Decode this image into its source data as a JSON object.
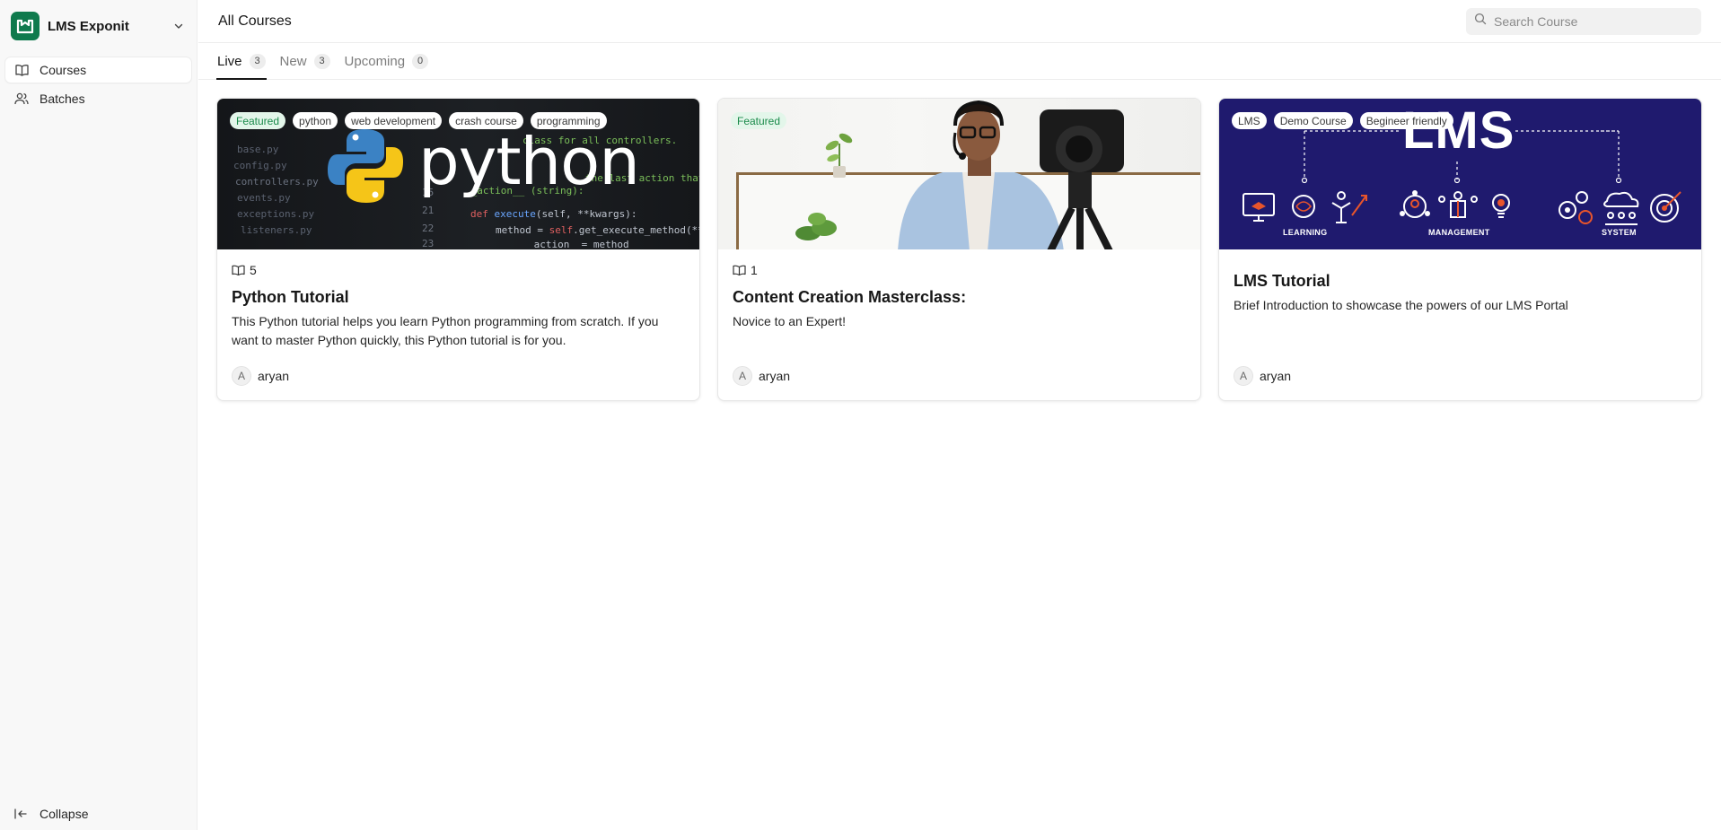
{
  "app": {
    "name": "LMS Exponit",
    "brand_color": "#0f7a4d"
  },
  "sidebar": {
    "items": [
      {
        "label": "Courses",
        "icon": "book-open-icon",
        "active": true
      },
      {
        "label": "Batches",
        "icon": "users-icon",
        "active": false
      }
    ],
    "collapse_label": "Collapse"
  },
  "header": {
    "title": "All Courses",
    "search_placeholder": "Search Course"
  },
  "tabs": [
    {
      "label": "Live",
      "count": "3",
      "active": true
    },
    {
      "label": "New",
      "count": "3",
      "active": false
    },
    {
      "label": "Upcoming",
      "count": "0",
      "active": false
    }
  ],
  "courses": [
    {
      "tags": [
        "Featured",
        "python",
        "web development",
        "crash course",
        "programming"
      ],
      "image_text": "python",
      "lessons": "5",
      "title": "Python Tutorial",
      "description": "This Python tutorial helps you learn Python programming from scratch. If you want to master Python quickly, this Python tutorial is for you.",
      "author_initial": "A",
      "author": "aryan"
    },
    {
      "tags": [
        "Featured"
      ],
      "lessons": "1",
      "title": "Content Creation Masterclass:",
      "description": "Novice to an Expert!",
      "author_initial": "A",
      "author": "aryan"
    },
    {
      "tags": [
        "LMS",
        "Demo Course",
        "Begineer friendly"
      ],
      "image_text": "LMS",
      "image_labels": [
        "LEARNING",
        "MANAGEMENT",
        "SYSTEM"
      ],
      "title": "LMS Tutorial",
      "description": "Brief Introduction to showcase the powers of our LMS Portal",
      "author_initial": "A",
      "author": "aryan"
    }
  ]
}
